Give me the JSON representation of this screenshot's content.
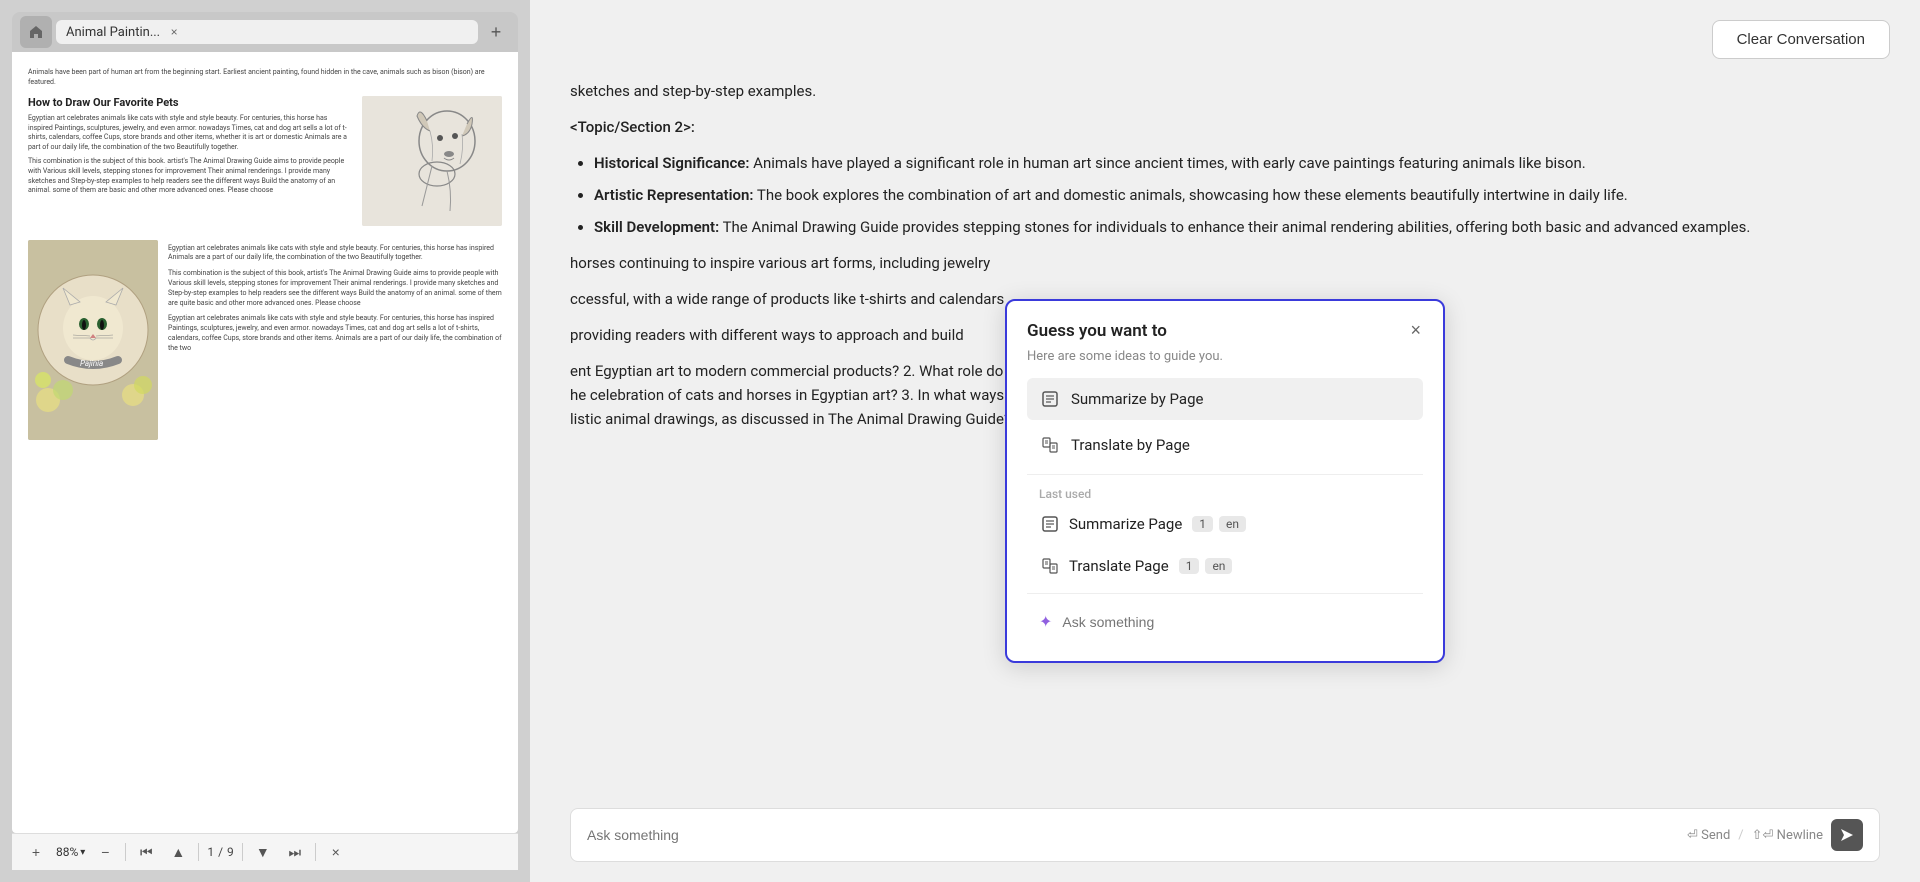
{
  "tabs": {
    "home_title": "🏠",
    "tab_label": "Animal Paintin...",
    "close_label": "×",
    "add_label": "+"
  },
  "toolbar": {
    "zoom_in": "+",
    "zoom_level": "88%",
    "zoom_out": "−",
    "separator": "|",
    "nav_first": "⏮",
    "nav_prev": "◀",
    "page_current": "1",
    "page_sep": "/",
    "page_total": "9",
    "nav_next": "▶",
    "nav_last": "⏭",
    "close": "×"
  },
  "pdf": {
    "intro_text": "Animals have been part of human art from the beginning start. Earliest ancient painting, found hidden in the cave, animals such as bison (bison) are featured.",
    "book_title": "How to Draw Our Favorite Pets",
    "book_subtitle": "Egyptian art celebrates animals like cats with style and style beauty. For centuries, this horse has inspired Paintings, sculptures, jewelry, and even armor. nowadays Times, cat and dog art sells a lot of t-shirts, calendars, coffee Cups, store brands and other items, whether it is art or domestic Animals are a part of our daily life, the combination of the two Beautifully together.",
    "body_text1": "This combination is the subject of this book. artist's The Animal Drawing Guide aims to provide people with Various skill levels, stepping stones for improvement Their animal renderings. I provide many sketches and Step-by-step examples to help readers see the different ways Build the anatomy of an animal. some of them are basic and other more advanced ones. Please choose",
    "body_text2": "Egyptian art celebrates animals like cats with style and style beauty. For centuries, this horse has inspired Animals are a part of our daily life, the combination of the two Beautifully together.",
    "body_text3": "This combination is the subject of this book, artist's The Animal Drawing Guide aims to provide people with Various skill levels, stepping stones for improvement Their animal renderings. I provide many sketches and Step-by-step examples to help readers see the different ways Build the anatomy of an animal. some of them are quite basic and other more advanced ones. Please choose",
    "body_text4": "Egyptian art celebrates animals like cats with style and style beauty. For centuries, this horse has inspired Paintings, sculptures, jewelry, and even armor. nowadays Times, cat and dog art sells a lot of t-shirts, calendars, coffee Cups, store brands and other items. Animals are a part of our daily life, the combination of the two"
  },
  "chat": {
    "clear_button": "Clear Conversation",
    "text_before": "sketches and step-by-step examples.",
    "topic_label": "<Topic/Section 2>:",
    "bullet1_title": "Historical Significance:",
    "bullet1_text": " Animals have played a significant role in human art since ancient times, with early cave paintings featuring animals like bison.",
    "bullet2_title": "Artistic Representation:",
    "bullet2_text": " The book explores the combination of art and domestic animals, showcasing how these elements beautifully intertwine in daily life.",
    "bullet3_title": "Skill Development:",
    "bullet3_text": " The Animal Drawing Guide provides stepping stones for individuals to enhance their animal rendering abilities, offering both basic and advanced examples.",
    "continuation1": "horses continuing to inspire various art forms, including jewelry",
    "continuation2": "ccessful, with a wide range of products like t-shirts and calendars",
    "continuation3": "providing readers with different ways to approach and build",
    "continuation4": "ent Egyptian art to modern commercial products? 2. What role do",
    "continuation4b": "he celebration of cats and horses in Egyptian art? 3. In what ways",
    "continuation4c": "listic animal drawings, as discussed in The Animal Drawing Guide?"
  },
  "popup": {
    "title": "Guess you want to",
    "subtitle": "Here are some ideas to guide you.",
    "close_icon": "×",
    "option1_label": "Summarize by Page",
    "option2_label": "Translate by Page",
    "section_label": "Last used",
    "last1_label": "Summarize Page",
    "last1_count": "1",
    "last1_lang": "en",
    "last2_label": "Translate Page",
    "last2_count": "1",
    "last2_lang": "en",
    "ask_placeholder": "Ask something"
  },
  "input_area": {
    "send_label": "⏎ Send",
    "newline_label": "⇧⏎ Newline",
    "separator": "/"
  }
}
